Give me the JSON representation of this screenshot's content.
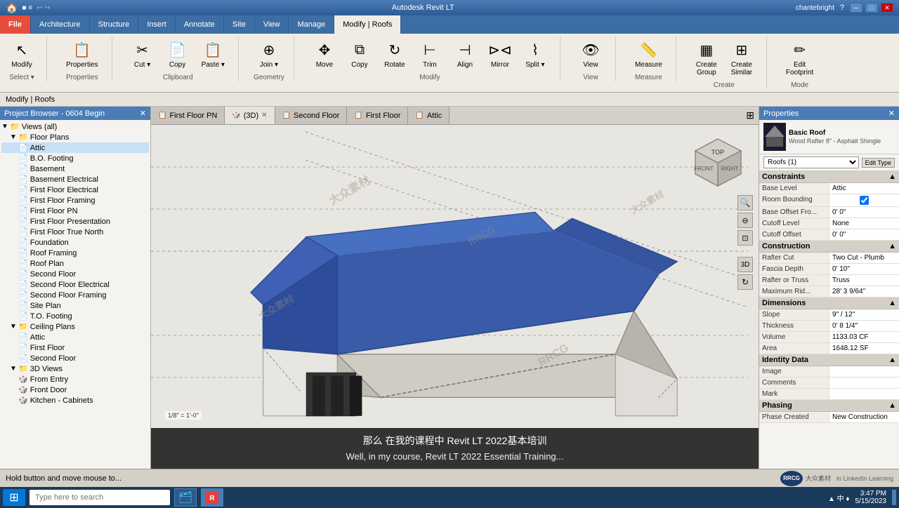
{
  "window": {
    "title": "Autodesk Revit LT",
    "user": "chantebright"
  },
  "ribbon": {
    "tabs": [
      "File",
      "Architecture",
      "Structure",
      "Insert",
      "Annotate",
      "Site",
      "View",
      "Manage",
      "Modify | Roofs"
    ],
    "active_tab": "Modify | Roofs",
    "groups": {
      "select": {
        "label": "Select",
        "buttons": [
          "Modify"
        ]
      },
      "properties": {
        "label": "Properties",
        "buttons": [
          "Properties"
        ]
      },
      "clipboard": {
        "label": "Clipboard",
        "buttons": [
          "Cut",
          "Copy",
          "Paste"
        ]
      },
      "geometry": {
        "label": "Geometry",
        "buttons": [
          "Join"
        ]
      },
      "modify": {
        "label": "Modify",
        "buttons": [
          "Move",
          "Copy",
          "Rotate",
          "Trim",
          "Align",
          "Mirror",
          "Split"
        ]
      },
      "view": {
        "label": "View",
        "buttons": [
          "View"
        ]
      },
      "measure": {
        "label": "Measure",
        "buttons": [
          "Measure"
        ]
      },
      "create": {
        "label": "Create",
        "buttons": [
          "Create Group",
          "Create Similar"
        ]
      },
      "mode": {
        "label": "Mode",
        "buttons": [
          "Edit Footprint"
        ]
      }
    }
  },
  "breadcrumb": "Modify | Roofs",
  "project_browser": {
    "title": "Project Browser - 0604 Begin",
    "views": {
      "label": "Views (all)",
      "floor_plans": {
        "label": "Floor Plans",
        "items": [
          "Attic",
          "B.O. Footing",
          "Basement",
          "Basement Electrical",
          "First Floor Electrical",
          "First Floor Framing",
          "First Floor PN",
          "First Floor Presentation",
          "First Floor True North",
          "Foundation",
          "Roof Framing",
          "Roof Plan",
          "Second Floor",
          "Second Floor Electrical",
          "Second Floor Framing",
          "Site Plan",
          "T.O. Footing"
        ]
      },
      "ceiling_plans": {
        "label": "Ceiling Plans",
        "items": [
          "Attic",
          "First Floor",
          "Second Floor"
        ]
      },
      "views_3d": {
        "label": "3D Views",
        "items": [
          "From Entry",
          "Front Door",
          "Kitchen - Cabinets"
        ]
      }
    }
  },
  "view_tabs": [
    {
      "label": "First Floor PN",
      "icon": "plan",
      "closeable": false
    },
    {
      "label": "(3D)",
      "icon": "3d",
      "closeable": true,
      "active": true
    },
    {
      "label": "Second Floor",
      "icon": "plan",
      "closeable": false
    },
    {
      "label": "First Floor",
      "icon": "plan",
      "closeable": false
    },
    {
      "label": "Attic",
      "icon": "plan",
      "closeable": false
    }
  ],
  "properties_panel": {
    "title": "Properties",
    "element_type": "Basic Roof",
    "element_type_detail": "Wood Rafter 8\" - Asphalt Shingle",
    "selector": "Roofs (1)",
    "sections": {
      "constraints": {
        "label": "Constraints",
        "rows": [
          {
            "label": "Base Level",
            "value": "Attic"
          },
          {
            "label": "Room Bounding",
            "value": "checked"
          },
          {
            "label": "Base Offset Fro...",
            "value": "0' 0\""
          },
          {
            "label": "Cutoff Level",
            "value": "None"
          },
          {
            "label": "Cutoff Offset",
            "value": "0' 0\""
          }
        ]
      },
      "construction": {
        "label": "Construction",
        "rows": [
          {
            "label": "Rafter Cut",
            "value": "Two Cut - Plumb"
          },
          {
            "label": "Fascia Depth",
            "value": "0' 10\""
          },
          {
            "label": "Rafter or Truss",
            "value": "Truss"
          },
          {
            "label": "Maximum Rid...",
            "value": "28' 3 9/64\""
          }
        ]
      },
      "dimensions": {
        "label": "Dimensions",
        "rows": [
          {
            "label": "Slope",
            "value": "9\" / 12\""
          },
          {
            "label": "Thickness",
            "value": "0' 8 1/4\""
          },
          {
            "label": "Volume",
            "value": "1133.03 CF"
          },
          {
            "label": "Area",
            "value": "1648.12 SF"
          }
        ]
      },
      "identity_data": {
        "label": "Identity Data",
        "rows": [
          {
            "label": "Image",
            "value": ""
          },
          {
            "label": "Comments",
            "value": ""
          },
          {
            "label": "Mark",
            "value": ""
          }
        ]
      },
      "phasing": {
        "label": "Phasing",
        "rows": [
          {
            "label": "Phase Created",
            "value": "New Construction"
          }
        ]
      }
    }
  },
  "status_bar": {
    "message": "Hold button and move mouse to..."
  },
  "subtitle": {
    "chinese": "那么 在我的课程中 Revit LT 2022基本培训",
    "english": "Well, in my course, Revit LT 2022 Essential Training..."
  },
  "taskbar": {
    "search_placeholder": "Type here to search",
    "time": "▲ 中 ♦\n3:47 PM"
  }
}
